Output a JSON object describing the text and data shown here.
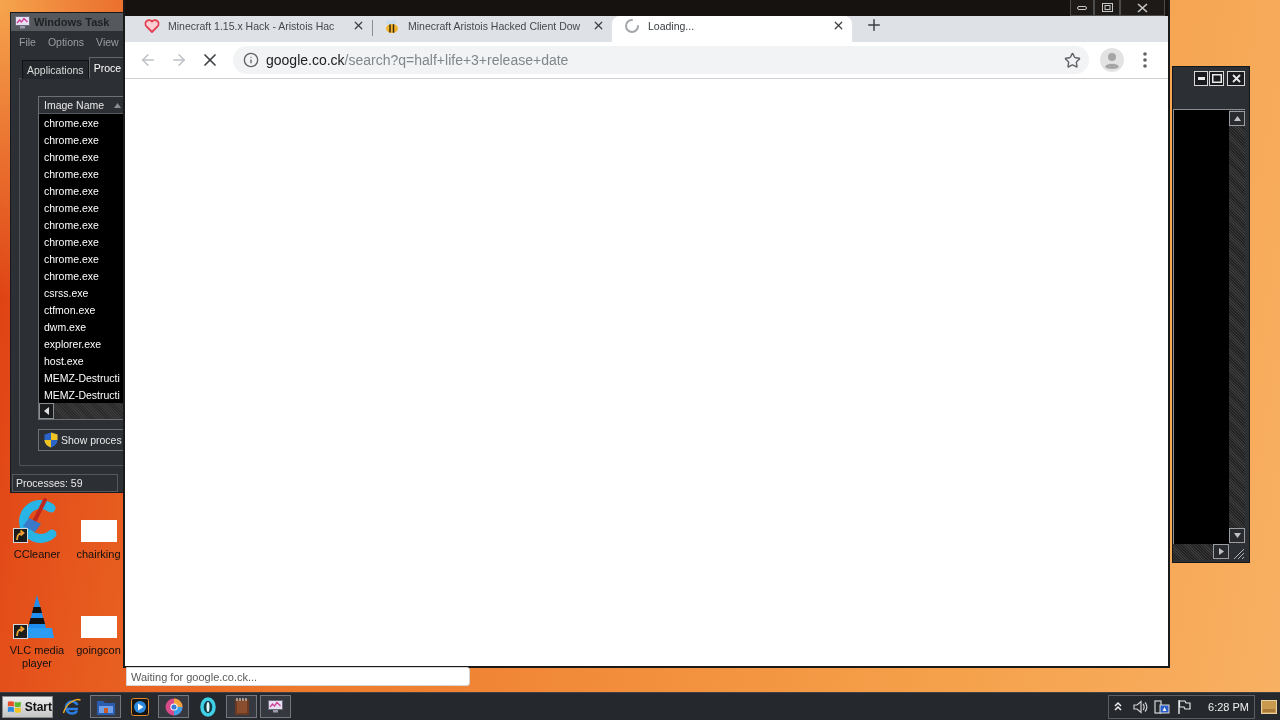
{
  "task_manager": {
    "title": "Windows Task",
    "menu": [
      "File",
      "Options",
      "View"
    ],
    "tabs": [
      {
        "label": "Applications",
        "selected": false
      },
      {
        "label": "Proce",
        "selected": true
      }
    ],
    "column": "Image Name",
    "processes": [
      "chrome.exe",
      "chrome.exe",
      "chrome.exe",
      "chrome.exe",
      "chrome.exe",
      "chrome.exe",
      "chrome.exe",
      "chrome.exe",
      "chrome.exe",
      "chrome.exe",
      "csrss.exe",
      "ctfmon.exe",
      "dwm.exe",
      "explorer.exe",
      "host.exe",
      "MEMZ-Destructi",
      "MEMZ-Destructi"
    ],
    "button": "Show proces",
    "status": "Processes: 59"
  },
  "desktop_icons": [
    {
      "label": "CCleaner",
      "kind": "cleaner",
      "shortcut": true
    },
    {
      "label": "chairking",
      "kind": "file",
      "shortcut": false
    },
    {
      "label": "VLC media player",
      "kind": "cone",
      "shortcut": true
    },
    {
      "label": "goingcon",
      "kind": "file",
      "shortcut": false
    }
  ],
  "browser": {
    "tabs": [
      {
        "title": "Minecraft 1.15.x Hack - Aristois Hac",
        "kind": "heart",
        "selected": false
      },
      {
        "title": "Minecraft Aristois Hacked Client Dow",
        "kind": "bee",
        "selected": false
      },
      {
        "title": "Loading...",
        "kind": "spinner",
        "selected": true
      }
    ],
    "back": {
      "disabled": true
    },
    "forward": {
      "disabled": true
    },
    "loading": true,
    "address": {
      "host": "google.co.ck",
      "path": "/search?q=half+life+3+release+date"
    },
    "status": "Waiting for google.co.ck..."
  },
  "taskbar": {
    "start": "Start",
    "buttons": [
      {
        "kind": "ie",
        "running": false
      },
      {
        "kind": "folder",
        "running": true
      },
      {
        "kind": "media",
        "running": false
      },
      {
        "kind": "chrome",
        "running": true
      },
      {
        "kind": "ring",
        "running": false
      },
      {
        "kind": "notebook",
        "running": true
      },
      {
        "kind": "taskmgr",
        "running": true
      }
    ],
    "clock": "6:28 PM"
  }
}
